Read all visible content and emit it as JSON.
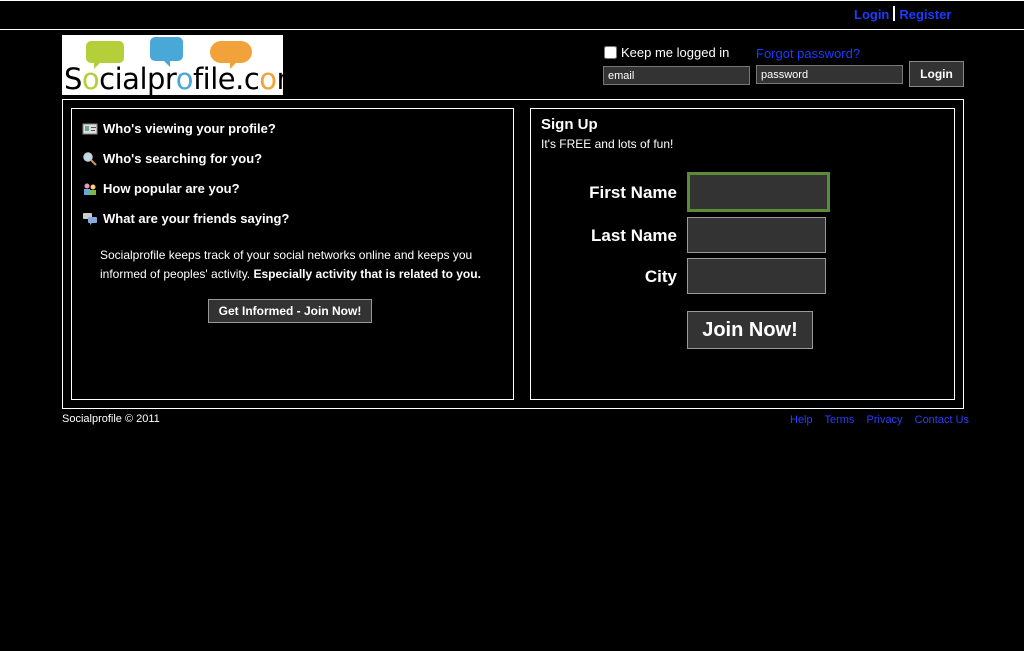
{
  "topnav": {
    "login": "Login",
    "register": "Register"
  },
  "logo": {
    "text_pre": "S",
    "o1": "o",
    "text_mid": "cialpr",
    "o2": "o",
    "text_post": "file.c",
    "o3": "o",
    "text_end": "m"
  },
  "header": {
    "keep_logged_in": "Keep me logged in",
    "forgot_password": "Forgot password?",
    "email_placeholder": "email",
    "password_placeholder": "password",
    "login_button": "Login"
  },
  "features": {
    "items": [
      {
        "label": "Who's viewing your profile?",
        "icon": "profile-card-icon"
      },
      {
        "label": "Who's searching for you?",
        "icon": "magnifier-icon"
      },
      {
        "label": "How popular are you?",
        "icon": "people-icon"
      },
      {
        "label": "What are your friends saying?",
        "icon": "chat-bubbles-icon"
      }
    ],
    "description": "Socialprofile keeps track of your social networks online and keeps you informed of peoples' activity.",
    "description_bold": "Especially activity that is related to you.",
    "join_button": "Get Informed - Join Now!"
  },
  "signup": {
    "title": "Sign Up",
    "subtitle": "It's FREE and lots of fun!",
    "first_name_label": "First Name",
    "last_name_label": "Last Name",
    "city_label": "City",
    "join_button": "Join Now!",
    "focus_color": "#5a8c3a"
  },
  "footer": {
    "copyright": "Socialprofile © 2011",
    "links": [
      "Help",
      "Terms",
      "Privacy",
      "Contact Us"
    ]
  }
}
